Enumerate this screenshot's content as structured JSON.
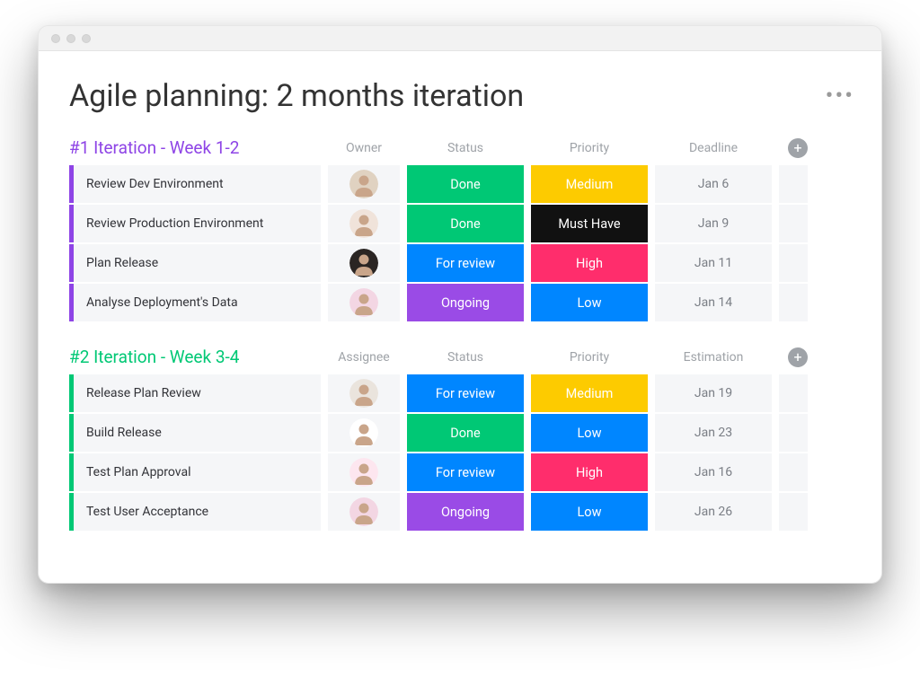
{
  "page_title": "Agile planning: 2 months iteration",
  "groups": [
    {
      "title": "#1 Iteration - Week 1-2",
      "color": "purple",
      "columns": [
        "Owner",
        "Status",
        "Priority",
        "Deadline"
      ],
      "rows": [
        {
          "task": "Review Dev Environment",
          "avatar_bg": "#e0d2c1",
          "status": "Done",
          "status_class": "c-done",
          "priority": "Medium",
          "priority_class": "c-medium",
          "date": "Jan 6"
        },
        {
          "task": "Review Production Environment",
          "avatar_bg": "#f0e3da",
          "status": "Done",
          "status_class": "c-done",
          "priority": "Must Have",
          "priority_class": "c-musthave",
          "date": "Jan 9"
        },
        {
          "task": "Plan Release",
          "avatar_bg": "#2a2523",
          "status": "For review",
          "status_class": "c-forreview",
          "priority": "High",
          "priority_class": "c-high",
          "date": "Jan 11"
        },
        {
          "task": "Analyse Deployment's Data",
          "avatar_bg": "#f3d6e3",
          "status": "Ongoing",
          "status_class": "c-ongoing",
          "priority": "Low",
          "priority_class": "c-low",
          "date": "Jan 14"
        }
      ]
    },
    {
      "title": "#2 Iteration - Week 3-4",
      "color": "green",
      "columns": [
        "Assignee",
        "Status",
        "Priority",
        "Estimation"
      ],
      "rows": [
        {
          "task": "Release Plan Review",
          "avatar_bg": "#eae4dd",
          "status": "For review",
          "status_class": "c-forreview",
          "priority": "Medium",
          "priority_class": "c-medium",
          "date": "Jan 19"
        },
        {
          "task": "Build Release",
          "avatar_bg": "#ffffff",
          "status": "Done",
          "status_class": "c-done",
          "priority": "Low",
          "priority_class": "c-low",
          "date": "Jan 23"
        },
        {
          "task": "Test Plan Approval",
          "avatar_bg": "#fde6ef",
          "status": "For review",
          "status_class": "c-forreview",
          "priority": "High",
          "priority_class": "c-high",
          "date": "Jan 16"
        },
        {
          "task": "Test User Acceptance",
          "avatar_bg": "#f3d6e3",
          "status": "Ongoing",
          "status_class": "c-ongoing",
          "priority": "Low",
          "priority_class": "c-low",
          "date": "Jan 26"
        }
      ]
    }
  ]
}
